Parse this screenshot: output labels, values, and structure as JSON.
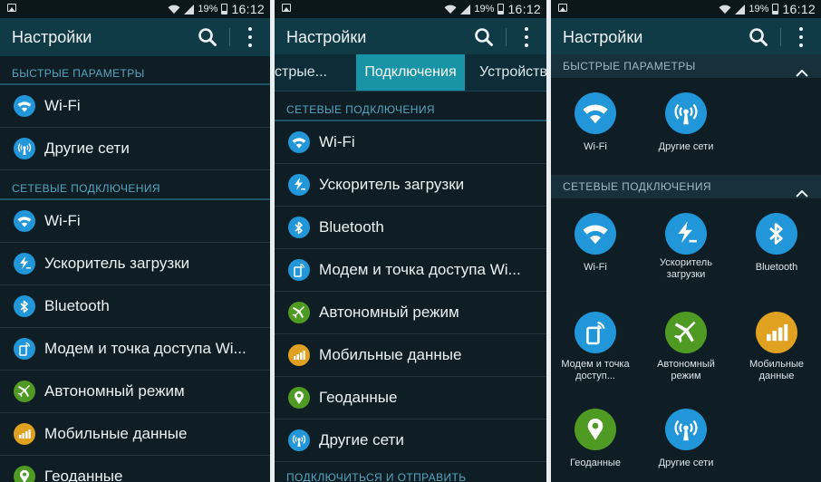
{
  "status": {
    "battery": "19%",
    "time": "16:12"
  },
  "appbar": {
    "title": "Настройки"
  },
  "panel1": {
    "quick_header": "БЫСТРЫЕ ПАРАМЕТРЫ",
    "quick_items": [
      "Wi-Fi",
      "Другие сети"
    ],
    "network_header": "СЕТЕВЫЕ ПОДКЛЮЧЕНИЯ",
    "network_items": [
      "Wi-Fi",
      "Ускоритель загрузки",
      "Bluetooth",
      "Модем и точка доступа Wi...",
      "Автономный режим",
      "Мобильные данные",
      "Геоданные"
    ]
  },
  "panel2": {
    "tabs": [
      "стрые...",
      "Подключения",
      "Устройство"
    ],
    "network_header": "СЕТЕВЫЕ ПОДКЛЮЧЕНИЯ",
    "items": [
      "Wi-Fi",
      "Ускоритель загрузки",
      "Bluetooth",
      "Модем и точка доступа Wi...",
      "Автономный режим",
      "Мобильные данные",
      "Геоданные",
      "Другие сети"
    ],
    "next_header": "ПОДКЛЮЧИТЬСЯ И ОТПРАВИТЬ"
  },
  "panel3": {
    "quick_header": "БЫСТРЫЕ ПАРАМЕТРЫ",
    "quick_tiles": [
      "Wi-Fi",
      "Другие сети"
    ],
    "network_header": "СЕТЕВЫЕ ПОДКЛЮЧЕНИЯ",
    "network_tiles": [
      "Wi-Fi",
      "Ускоритель загрузки",
      "Bluetooth",
      "Модем и точка доступ...",
      "Автономный режим",
      "Мобильные данные",
      "Геоданные",
      "Другие сети"
    ]
  },
  "icons": {
    "wifi": "wifi-icon",
    "other_networks": "other-networks-icon",
    "booster": "download-booster-icon",
    "bluetooth": "bluetooth-icon",
    "hotspot": "hotspot-icon",
    "airplane": "airplane-icon",
    "mobile_data": "mobile-data-icon",
    "location": "location-icon"
  },
  "colors": {
    "blue": "#2196d8",
    "green": "#4f9a23",
    "orange": "#e0a020",
    "accent": "#1993a6"
  }
}
